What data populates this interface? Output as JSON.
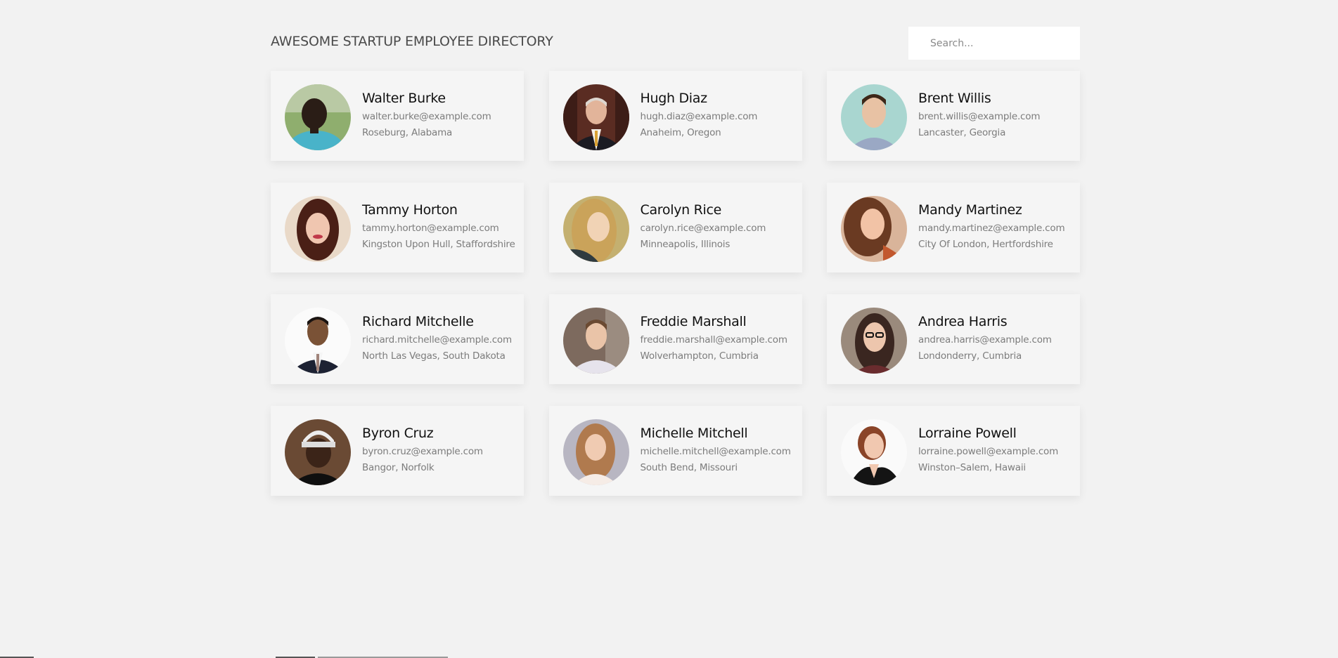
{
  "header": {
    "title": "AWESOME STARTUP EMPLOYEE DIRECTORY",
    "search_placeholder": "Search..."
  },
  "employees": [
    {
      "name": "Walter Burke",
      "email": "walter.burke@example.com",
      "location": "Roseburg, Alabama"
    },
    {
      "name": "Hugh Diaz",
      "email": "hugh.diaz@example.com",
      "location": "Anaheim, Oregon"
    },
    {
      "name": "Brent Willis",
      "email": "brent.willis@example.com",
      "location": "Lancaster, Georgia"
    },
    {
      "name": "Tammy Horton",
      "email": "tammy.horton@example.com",
      "location": "Kingston Upon Hull, Staffordshire"
    },
    {
      "name": "Carolyn Rice",
      "email": "carolyn.rice@example.com",
      "location": "Minneapolis, Illinois"
    },
    {
      "name": "Mandy Martinez",
      "email": "mandy.martinez@example.com",
      "location": "City Of London, Hertfordshire"
    },
    {
      "name": "Richard Mitchelle",
      "email": "richard.mitchelle@example.com",
      "location": "North Las Vegas, South Dakota"
    },
    {
      "name": "Freddie Marshall",
      "email": "freddie.marshall@example.com",
      "location": "Wolverhampton, Cumbria"
    },
    {
      "name": "Andrea Harris",
      "email": "andrea.harris@example.com",
      "location": "Londonderry, Cumbria"
    },
    {
      "name": "Byron Cruz",
      "email": "byron.cruz@example.com",
      "location": "Bangor, Norfolk"
    },
    {
      "name": "Michelle Mitchell",
      "email": "michelle.mitchell@example.com",
      "location": "South Bend, Missouri"
    },
    {
      "name": "Lorraine Powell",
      "email": "lorraine.powell@example.com",
      "location": "Winston–Salem, Hawaii"
    }
  ]
}
